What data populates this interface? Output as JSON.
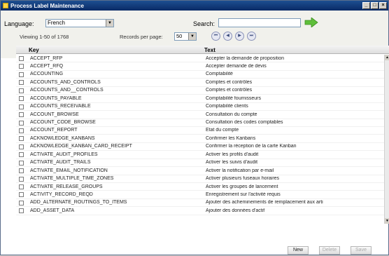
{
  "window": {
    "title": "Process Label Maintenance",
    "controls": [
      "_",
      "□",
      "×"
    ]
  },
  "toolbar": {
    "language_label": "Language:",
    "language_value": "French",
    "search_label": "Search:",
    "search_value": ""
  },
  "pager": {
    "viewing": "Viewing 1-50 of 1768",
    "records_per_page_label": "Records per page:",
    "records_per_page_value": "50",
    "nav": [
      "first",
      "previous",
      "next",
      "last"
    ]
  },
  "grid": {
    "columns": [
      "Key",
      "Text"
    ],
    "rows": [
      {
        "key": "ACCEPT_RFP",
        "text": "Accepter la demande de proposition"
      },
      {
        "key": "ACCEPT_RFQ",
        "text": "Accepter demande de devis"
      },
      {
        "key": "ACCOUNTING",
        "text": "Comptabilité"
      },
      {
        "key": "ACCOUNTS_AND_CONTROLS",
        "text": "Comptes et contrôles"
      },
      {
        "key": "ACCOUNTS_AND__CONTROLS",
        "text": "Comptes et contrôles"
      },
      {
        "key": "ACCOUNTS_PAYABLE",
        "text": "Comptabilité fournisseurs"
      },
      {
        "key": "ACCOUNTS_RECEIVABLE",
        "text": "Comptabilité clients"
      },
      {
        "key": "ACCOUNT_BROWSE",
        "text": "Consultation du compte"
      },
      {
        "key": "ACCOUNT_CODE_BROWSE",
        "text": "Consultation des codes comptables"
      },
      {
        "key": "ACCOUNT_REPORT",
        "text": "Etat du compte"
      },
      {
        "key": "ACKNOWLEDGE_KANBANS",
        "text": "Confirmer les Kanbans"
      },
      {
        "key": "ACKNOWLEDGE_KANBAN_CARD_RECEIPT",
        "text": "Confirmer la réception de la carte Kanban"
      },
      {
        "key": "ACTIVATE_AUDIT_PROFILES",
        "text": "Activer les profils d'audit"
      },
      {
        "key": "ACTIVATE_AUDIT_TRAILS",
        "text": "Activer les suivis d'audit"
      },
      {
        "key": "ACTIVATE_EMAIL_NOTIFICATION",
        "text": "Activer la notification par e-mail"
      },
      {
        "key": "ACTIVATE_MULTIPLE_TIME_ZONES",
        "text": "Activer plusieurs fuseaux horaires"
      },
      {
        "key": "ACTIVATE_RELEASE_GROUPS",
        "text": "Activer les groupes de lancement"
      },
      {
        "key": "ACTIVITY_RECORD_REQD",
        "text": "Enregistrement sur l'activité requis"
      },
      {
        "key": "ADD_ALTERNATE_ROUTINGS_TO_ITEMS",
        "text": "Ajouter des acheminements de remplacement aux arti"
      },
      {
        "key": "ADD_ASSET_DATA",
        "text": "Ajouter des données d'actif"
      }
    ]
  },
  "footer": {
    "new_label": "New",
    "delete_label": "Delete",
    "save_label": "Save"
  },
  "colors": {
    "titlebar": "#1d4f91",
    "go_arrow": "#5fbf3a"
  }
}
